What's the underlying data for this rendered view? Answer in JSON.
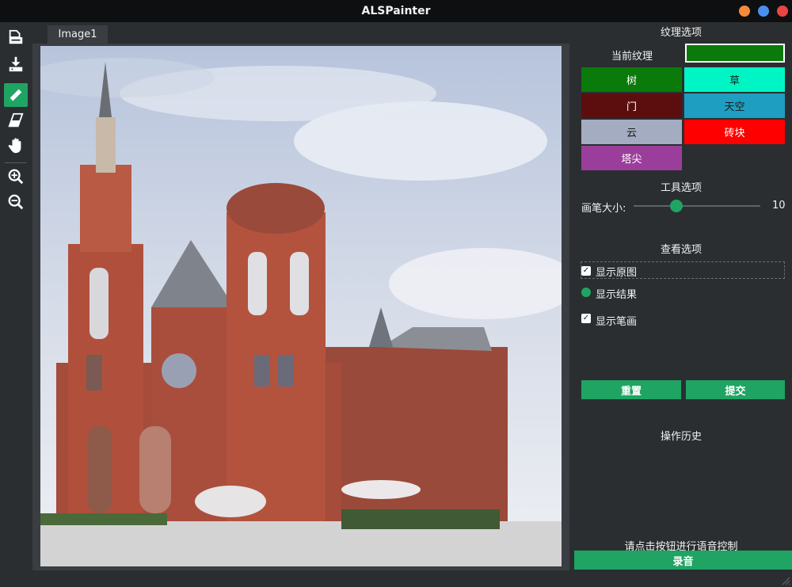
{
  "window": {
    "title": "ALSPainter"
  },
  "tabs": [
    {
      "label": "Image1"
    }
  ],
  "panel": {
    "texture_title": "纹理选项",
    "current_texture_label": "当前纹理",
    "current_texture_color": "#0a7a0a",
    "textures": [
      {
        "label": "树",
        "color": "#0a7a0a",
        "text_color": "#ffffff"
      },
      {
        "label": "草",
        "color": "#00f5c4",
        "text_color": "#1a1a1a"
      },
      {
        "label": "门",
        "color": "#5c0e0e",
        "text_color": "#ffffff"
      },
      {
        "label": "天空",
        "color": "#1e9ec0",
        "text_color": "#1a1a1a"
      },
      {
        "label": "云",
        "color": "#a3acc0",
        "text_color": "#1a1a1a"
      },
      {
        "label": "砖块",
        "color": "#ff0000",
        "text_color": "#ffffff"
      },
      {
        "label": "塔尖",
        "color": "#9b3e9b",
        "text_color": "#ffffff"
      }
    ],
    "tool_title": "工具选项",
    "brush_size_label": "画笔大小:",
    "brush_size_value": "10",
    "view_title": "查看选项",
    "show_original": "显示原图",
    "show_result": "显示结果",
    "show_strokes": "显示笔画",
    "reset_label": "重置",
    "submit_label": "提交",
    "history_title": "操作历史",
    "voice_hint": "请点击按钮进行语音控制",
    "record_label": "录音"
  },
  "colors": {
    "accent": "#1fa463",
    "background": "#2b2e31"
  },
  "icons": [
    "open-file-icon",
    "save-icon",
    "pencil-icon",
    "eraser-icon",
    "hand-icon",
    "zoom-in-icon",
    "zoom-out-icon"
  ]
}
